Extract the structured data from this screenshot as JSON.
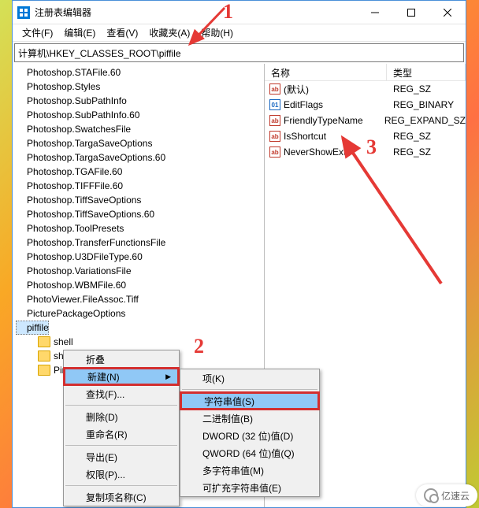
{
  "title": "注册表编辑器",
  "menubar": [
    "文件(F)",
    "编辑(E)",
    "查看(V)",
    "收藏夹(A)",
    "帮助(H)"
  ],
  "address": "计算机\\HKEY_CLASSES_ROOT\\piffile",
  "tree_items": [
    "Photoshop.STAFile.60",
    "Photoshop.Styles",
    "Photoshop.SubPathInfo",
    "Photoshop.SubPathInfo.60",
    "Photoshop.SwatchesFile",
    "Photoshop.TargaSaveOptions",
    "Photoshop.TargaSaveOptions.60",
    "Photoshop.TGAFile.60",
    "Photoshop.TIFFFile.60",
    "Photoshop.TiffSaveOptions",
    "Photoshop.TiffSaveOptions.60",
    "Photoshop.ToolPresets",
    "Photoshop.TransferFunctionsFile",
    "Photoshop.U3DFileType.60",
    "Photoshop.VariationsFile",
    "Photoshop.WBMFile.60",
    "PhotoViewer.FileAssoc.Tiff",
    "PicturePackageOptions"
  ],
  "tree_selected": "piffile",
  "tree_after": [
    "shell",
    "shellex",
    "PinnedFiles"
  ],
  "list_headers": {
    "name": "名称",
    "type": "类型"
  },
  "list_rows": [
    {
      "icon": "ab",
      "name": "(默认)",
      "type": "REG_SZ"
    },
    {
      "icon": "bin",
      "name": "EditFlags",
      "type": "REG_BINARY"
    },
    {
      "icon": "ab",
      "name": "FriendlyTypeName",
      "type": "REG_EXPAND_SZ"
    },
    {
      "icon": "ab",
      "name": "IsShortcut",
      "type": "REG_SZ"
    },
    {
      "icon": "ab",
      "name": "NeverShowExt",
      "type": "REG_SZ"
    }
  ],
  "context1": {
    "items": [
      {
        "label": "折叠"
      },
      {
        "label": "新建(N)",
        "hi": true,
        "sub": true
      },
      {
        "label": "查找(F)..."
      },
      {
        "sep": true
      },
      {
        "label": "删除(D)"
      },
      {
        "label": "重命名(R)"
      },
      {
        "sep": true
      },
      {
        "label": "导出(E)"
      },
      {
        "label": "权限(P)..."
      },
      {
        "sep": true
      },
      {
        "label": "复制项名称(C)"
      }
    ]
  },
  "context2": {
    "items": [
      {
        "label": "项(K)"
      },
      {
        "sep": true
      },
      {
        "label": "字符串值(S)",
        "hi": true
      },
      {
        "label": "二进制值(B)"
      },
      {
        "label": "DWORD (32 位)值(D)"
      },
      {
        "label": "QWORD (64 位)值(Q)"
      },
      {
        "label": "多字符串值(M)"
      },
      {
        "label": "可扩充字符串值(E)"
      }
    ]
  },
  "annot": {
    "n1": "1",
    "n2": "2",
    "n3": "3"
  },
  "logo": "亿速云"
}
